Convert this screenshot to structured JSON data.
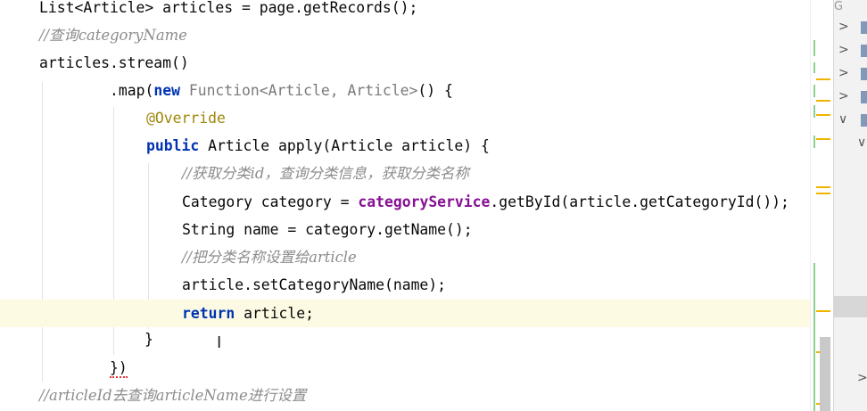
{
  "editor": {
    "lines": [
      {
        "code": [
          "List<Article> articles = page.getRecords();"
        ]
      },
      {
        "comment": "//查询categoryName"
      },
      {
        "code": [
          "articles.stream()"
        ]
      },
      {
        "code": [
          ".map(",
          "new",
          " ",
          "Function<Article, Article>",
          "() {"
        ]
      },
      {
        "annotation": "@Override"
      },
      {
        "code": [
          "public",
          " Article apply(Article article) {"
        ]
      },
      {
        "comment": "//获取分类id，查询分类信息，获取分类名称"
      },
      {
        "code": [
          "Category category = ",
          "categoryService",
          ".getById(article.getCategoryId());"
        ]
      },
      {
        "code": [
          "String name = category.getName();"
        ]
      },
      {
        "comment": "//把分类名称设置给article"
      },
      {
        "code": [
          "article.setCategoryName(name);"
        ]
      },
      {
        "code": [
          "return",
          " article;"
        ]
      },
      {
        "code": [
          "}"
        ]
      },
      {
        "code": [
          "})"
        ]
      },
      {
        "comment": "//articleId去查询articleName进行设置"
      }
    ]
  },
  "right_panel": {
    "top_label": "G",
    "rows": [
      {
        "chevron": ">"
      },
      {
        "chevron": ">"
      },
      {
        "chevron": ">"
      },
      {
        "chevron": ">"
      },
      {
        "chevron": "∨"
      },
      {
        "chevron": "∨"
      }
    ],
    "bottom_chevron": ">"
  },
  "colors": {
    "keyword": "#0033b3",
    "comment": "#8c8c8c",
    "annotation": "#9e880d",
    "field": "#871094",
    "current_line": "#fcfae2",
    "change_marker": "#f0b400"
  }
}
